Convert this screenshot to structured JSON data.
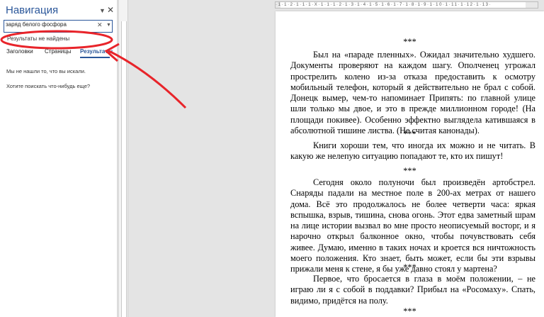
{
  "nav": {
    "title": "Навигация",
    "dropdown_icon": "▼",
    "close_icon": "✕",
    "search_value": "заряд белого фосфора",
    "search_clear_icon": "✕",
    "search_options_icon": "▼",
    "no_results": "Результаты не найдены",
    "tabs": [
      "Заголовки",
      "Страницы",
      "Результаты"
    ],
    "active_tab": "Результаты",
    "message1": "Мы не нашли то, что вы искали.",
    "message2": "Хотите поискать что-нибудь еще?"
  },
  "ruler": {
    "numbers": "·1·1·2·1·1·1·X·1·1·1·2·1·3·1·4·1·5·1·6·1·7·1·8·1·9·1·10·1·11·1·12·1·13·"
  },
  "document": {
    "stars": "***",
    "paragraphs": [
      "Был на «параде пленных». Ожидал значительно худшего. Документы проверяют на каждом шагу. Ополченец угрожал прострелить колено из-за отказа предоставить к осмотру мобильный телефон, который я действительно не брал с собой. Донецк вымер, чем-то напоминает Припять: по главной улице шли только мы двое, и это в прежде миллионном городе! (На площади покивее). Особенно эффектно выглядела катившаяся в абсолютной тишине листва. (Не считая канонады).",
      "Книги хороши тем, что иногда их можно и не читать. В какую же нелепую ситуацию попадают те, кто их пишут!",
      "Сегодня около полуночи был произведён артобстрел. Снаряды падали на местное поле в 200-ах метрах от нашего дома. Всё это продолжалось не более четверти часа: яркая вспышка, взрыв, тишина, снова огонь. Этот едва заметный шрам на лице истории вызвал во мне просто неописуемый восторг, и я нарочно открыл балконное окно, чтобы почувствовать себя живее. Думаю, именно в таких ночах и кроется вся ничтожность моего положения. Кто знает, быть может, если бы эти взрывы прижали меня к стене, я бы уже давно стоял у мартена?",
      "Первое, что бросается в глаза в моём положении, – не играю ли я с собой в поддавки? Прибыл на «Росомаху». Спать, видимо, придётся на полу."
    ]
  },
  "annotation": {
    "color": "#e8242a"
  }
}
